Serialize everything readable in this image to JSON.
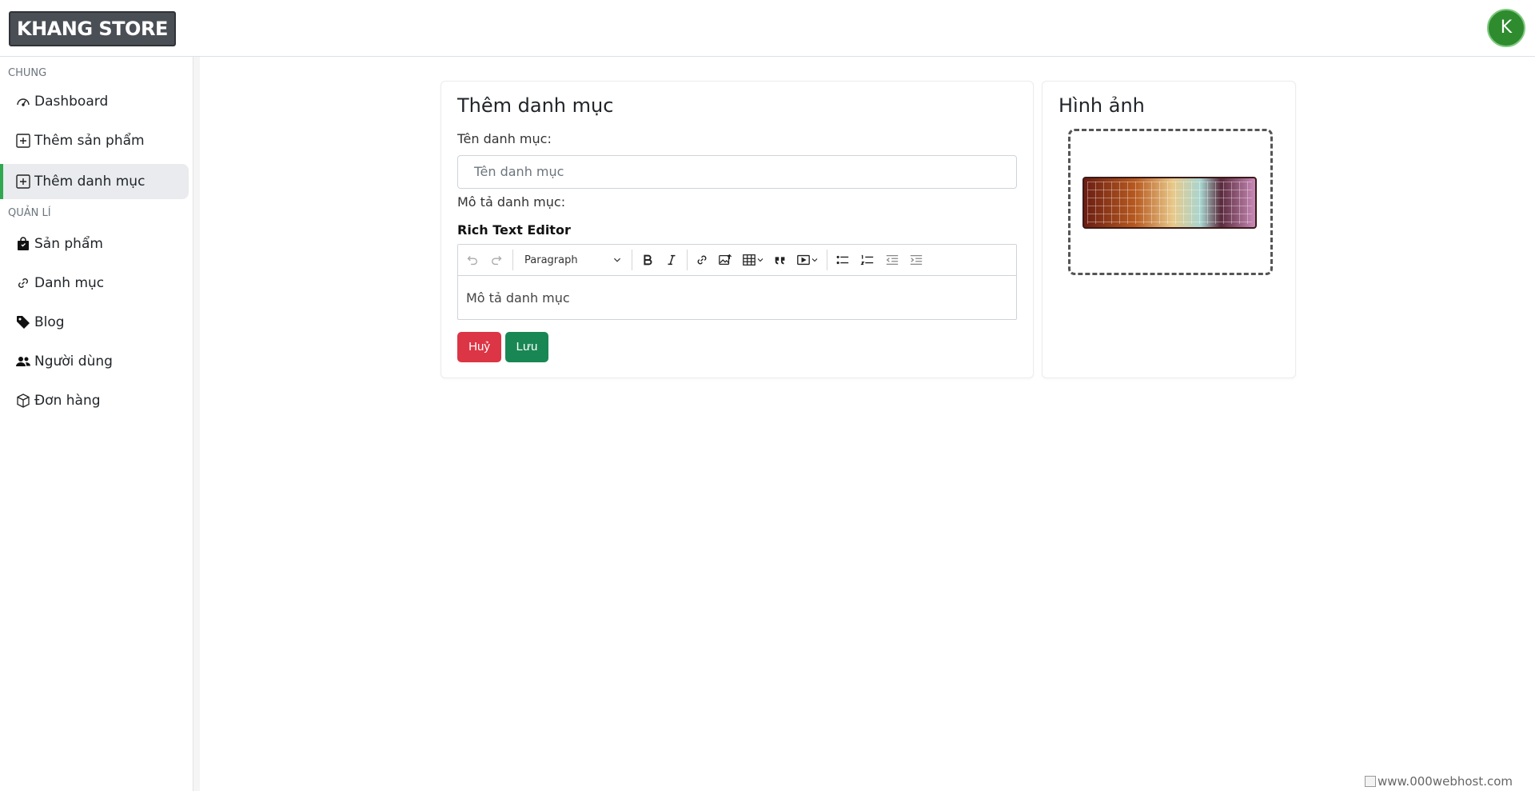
{
  "brand": {
    "logo_text": "KHANG STORE",
    "avatar_initial": "K"
  },
  "sidebar": {
    "sections": [
      {
        "title": "CHUNG"
      },
      {
        "title": "QUẢN LÍ"
      }
    ],
    "items": [
      {
        "label": "Dashboard",
        "icon": "speedometer-icon"
      },
      {
        "label": "Thêm sản phẩm",
        "icon": "plus-square-icon"
      },
      {
        "label": "Thêm danh mục",
        "icon": "plus-square-icon",
        "active": true
      },
      {
        "label": "Sản phẩm",
        "icon": "bag-icon"
      },
      {
        "label": "Danh mục",
        "icon": "link-icon"
      },
      {
        "label": "Blog",
        "icon": "tag-icon"
      },
      {
        "label": "Người dùng",
        "icon": "people-icon"
      },
      {
        "label": "Đơn hàng",
        "icon": "box-icon"
      }
    ]
  },
  "form": {
    "title": "Thêm danh mục",
    "name_label": "Tên danh mục:",
    "name_placeholder": "Tên danh mục",
    "desc_label": "Mô tả danh mục:",
    "editor_label": "Rich Text Editor",
    "editor_format": "Paragraph",
    "editor_placeholder": "Mô tả danh mục",
    "cancel_label": "Huỷ",
    "save_label": "Lưu"
  },
  "image_panel": {
    "title": "Hình ảnh"
  },
  "footer": {
    "banner_alt": "www.000webhost.com"
  },
  "colors": {
    "active_accent": "#2fa84f",
    "cancel": "#dc3545",
    "save": "#198754",
    "avatar": "#2e8b2e"
  }
}
